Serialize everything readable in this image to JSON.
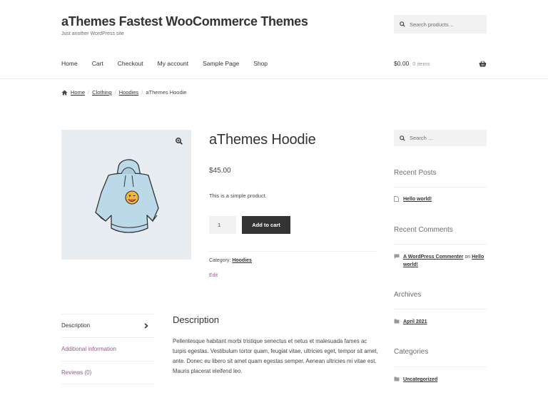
{
  "site": {
    "title": "aThemes Fastest WooCommerce Themes",
    "tagline": "Just another WordPress site"
  },
  "header_search": {
    "placeholder": "Search products…"
  },
  "nav": {
    "items": [
      "Home",
      "Cart",
      "Checkout",
      "My account",
      "Sample Page",
      "Shop"
    ]
  },
  "cart": {
    "amount": "$0.00",
    "count": "0 items"
  },
  "breadcrumb": {
    "home": "Home",
    "items": [
      "Clothing",
      "Hoodies"
    ],
    "current": "aThemes Hoodie",
    "separator": "/"
  },
  "product": {
    "title": "aThemes Hoodie",
    "price": "$45.00",
    "short_description": "This is a simple product.",
    "quantity": "1",
    "add_to_cart": "Add to cart",
    "category_label": "Category:",
    "category": "Hoodies",
    "edit": "Edit"
  },
  "tabs": {
    "description": "Description",
    "additional": "Additional information",
    "reviews": "Reviews (0)"
  },
  "description": {
    "heading": "Description",
    "text": "Pellentesque habitant morbi tristique senectus et netus et malesuada fames ac turpis egestas. Vestibulum tortor quam, feugiat vitae, ultricies eget, tempor sit amet, ante. Donec eu libero sit amet quam egestas semper. Aenean ultricies mi vitae est. Mauris placerat eleifend leo."
  },
  "sidebar": {
    "search_placeholder": "Search …",
    "recent_posts": {
      "title": "Recent Posts",
      "items": [
        "Hello world!"
      ]
    },
    "recent_comments": {
      "title": "Recent Comments",
      "author": "A WordPress Commenter",
      "on": "on",
      "post": "Hello world!"
    },
    "archives": {
      "title": "Archives",
      "items": [
        "April 2021"
      ]
    },
    "categories": {
      "title": "Categories",
      "items": [
        "Uncategorized"
      ]
    }
  },
  "colors": {
    "accent": "#96588a",
    "button": "#333333",
    "text": "#43454b"
  }
}
